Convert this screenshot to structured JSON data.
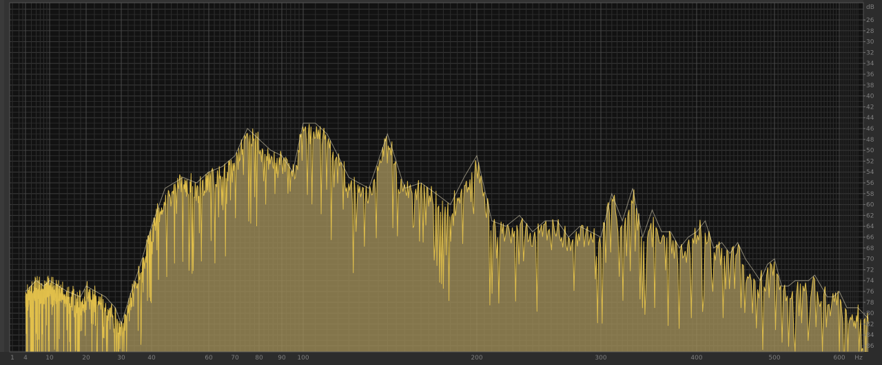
{
  "chart_data": {
    "type": "area",
    "title": "",
    "xlabel": "",
    "ylabel": "",
    "x_scale": "log",
    "xlim": [
      1,
      700
    ],
    "ylim": [
      -87,
      -24
    ],
    "y_unit_label": "dB",
    "x_unit_label": "Hz",
    "grid": true,
    "x_tick_labels": [
      "1",
      "4",
      "10",
      "20",
      "30",
      "40",
      "60",
      "70",
      "80",
      "90",
      "100",
      "200",
      "300",
      "400",
      "500",
      "600"
    ],
    "y_tick_labels": [
      "26",
      "28",
      "30",
      "32",
      "34",
      "36",
      "38",
      "40",
      "42",
      "44",
      "46",
      "48",
      "50",
      "52",
      "54",
      "56",
      "58",
      "60",
      "62",
      "64",
      "66",
      "68",
      "70",
      "72",
      "74",
      "76",
      "78",
      "80",
      "82",
      "84",
      "86"
    ],
    "colors": {
      "fill": "#a08f5a",
      "line": "#e8c54c",
      "peak": "#fff6d0",
      "background": "#121212",
      "grid": "#3f3f3f"
    },
    "series": [
      {
        "x": [
          4,
          6,
          8,
          10,
          14,
          18,
          20,
          25,
          28,
          30,
          33,
          36,
          40,
          44,
          50,
          55,
          60,
          65,
          70,
          75,
          80,
          85,
          90,
          95,
          100,
          105,
          110,
          120,
          130,
          140,
          150,
          160,
          170,
          180,
          190,
          200,
          210,
          220,
          230,
          240,
          250,
          260,
          270,
          280,
          290,
          300,
          310,
          320,
          330,
          340,
          350,
          360,
          370,
          380,
          390,
          400,
          410,
          420,
          430,
          440,
          450,
          460,
          470,
          480,
          490,
          500,
          510,
          520,
          530,
          540,
          550,
          560,
          570,
          580,
          590,
          600,
          620,
          650,
          680
        ],
        "values": [
          -76,
          -74,
          -75,
          -74,
          -76,
          -77,
          -75,
          -77,
          -79,
          -82,
          -76,
          -71,
          -64,
          -57,
          -55,
          -56,
          -54,
          -53,
          -51,
          -46,
          -48,
          -50,
          -51,
          -54,
          -45,
          -45,
          -47,
          -55,
          -57,
          -47,
          -57,
          -56,
          -58,
          -60,
          -55,
          -51,
          -63,
          -64,
          -62,
          -65,
          -63,
          -63,
          -66,
          -64,
          -65,
          -66,
          -58,
          -63,
          -57,
          -66,
          -61,
          -65,
          -65,
          -68,
          -66,
          -65,
          -63,
          -68,
          -67,
          -69,
          -67,
          -70,
          -72,
          -74,
          -71,
          -70,
          -75,
          -75,
          -74,
          -74,
          -74,
          -73,
          -75,
          -77,
          -77,
          -76,
          -79,
          -79,
          -81
        ]
      }
    ]
  }
}
